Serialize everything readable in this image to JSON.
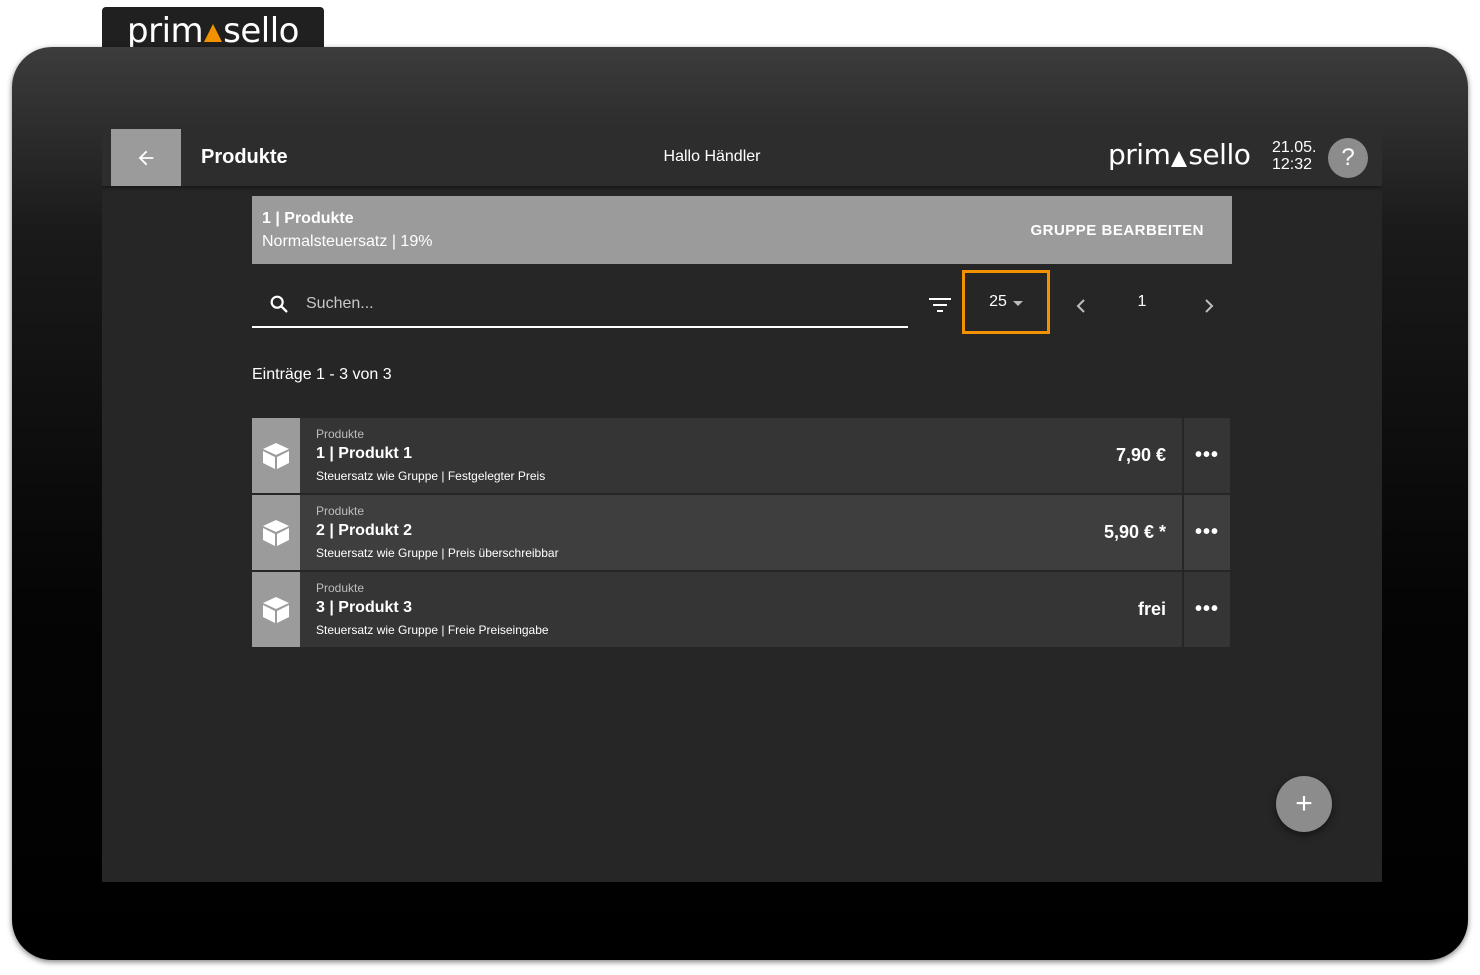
{
  "brand": {
    "left": "prim",
    "right": "sello",
    "accent_color": "#f39200"
  },
  "topbar": {
    "back_icon": "arrow-left-icon",
    "title": "Produkte",
    "greeting": "Hallo Händler",
    "date": "21.05.",
    "time": "12:32",
    "help_label": "?"
  },
  "group": {
    "title": "1 | Produkte",
    "subtitle": "Normalsteuersatz | 19%",
    "edit_label": "GRUPPE BEARBEITEN"
  },
  "search": {
    "placeholder": "Suchen...",
    "value": ""
  },
  "pagination": {
    "per_page": "25",
    "current_page": "1"
  },
  "entries_text": "Einträge 1 - 3 von 3",
  "products": [
    {
      "category": "Produkte",
      "name": "1 | Produkt 1",
      "description": "Steuersatz wie Gruppe | Festgelegter Preis",
      "price": "7,90 €"
    },
    {
      "category": "Produkte",
      "name": "2 | Produkt 2",
      "description": "Steuersatz wie Gruppe | Preis überschreibbar",
      "price": "5,90 € *"
    },
    {
      "category": "Produkte",
      "name": "3 | Produkt 3",
      "description": "Steuersatz wie Gruppe | Freie Preiseingabe",
      "price": "frei"
    }
  ],
  "more_label": "•••",
  "fab_label": "+"
}
